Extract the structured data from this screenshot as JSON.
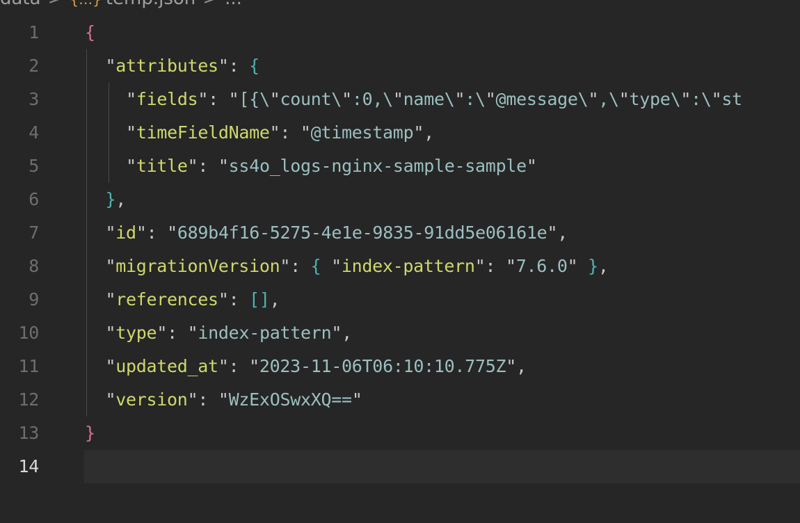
{
  "breadcrumb": {
    "folder": "data",
    "separator": ">",
    "file_icon": "{…}",
    "file": "temp.json",
    "more": "..."
  },
  "editor": {
    "current_line": 14,
    "lines": [
      {
        "number": "1",
        "text": "{"
      },
      {
        "number": "2",
        "text": "  \"attributes\": {"
      },
      {
        "number": "3",
        "text": "    \"fields\": \"[{\\\"count\\\":0,\\\"name\\\":\\\"@message\\\",\\\"type\\\":\\\"st"
      },
      {
        "number": "4",
        "text": "    \"timeFieldName\": \"@timestamp\","
      },
      {
        "number": "5",
        "text": "    \"title\": \"ss4o_logs-nginx-sample-sample\""
      },
      {
        "number": "6",
        "text": "  },"
      },
      {
        "number": "7",
        "text": "  \"id\": \"689b4f16-5275-4e1e-9835-91dd5e06161e\","
      },
      {
        "number": "8",
        "text": "  \"migrationVersion\": { \"index-pattern\": \"7.6.0\" },"
      },
      {
        "number": "9",
        "text": "  \"references\": [],"
      },
      {
        "number": "10",
        "text": "  \"type\": \"index-pattern\","
      },
      {
        "number": "11",
        "text": "  \"updated_at\": \"2023-11-06T06:10:10.775Z\","
      },
      {
        "number": "12",
        "text": "  \"version\": \"WzExOSwxXQ==\""
      },
      {
        "number": "13",
        "text": "}"
      },
      {
        "number": "14",
        "text": ""
      }
    ]
  },
  "colors": {
    "background": "#262626",
    "current_line": "#2e2e2e",
    "key": "#cfd86b",
    "string": "#9cbfc0",
    "outer_brace": "#d1709a",
    "inner_brace": "#4fb3b0",
    "line_number": "#6e6e6e"
  }
}
